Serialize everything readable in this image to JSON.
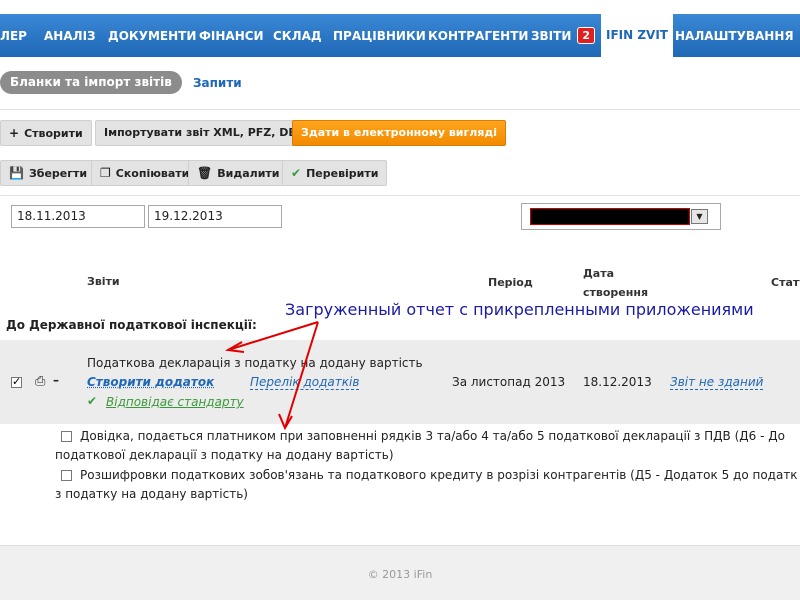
{
  "nav": {
    "items": [
      "ЛЕР",
      "АНАЛІЗ",
      "ДОКУМЕНТИ",
      "ФІНАНСИ",
      "СКЛАД",
      "ПРАЦІВНИКИ",
      "КОНТРАГЕНТИ",
      "ЗВІТИ"
    ],
    "badge": "2",
    "active": "IFIN ZVIT",
    "settings": "НАЛАШТУВАННЯ"
  },
  "subtabs": {
    "active": "Бланки та імпорт звітів",
    "other": "Запити"
  },
  "toolbar1": {
    "create": "Створити",
    "import": "Імпортувати звіт XML, PFZ, DBF",
    "submit": "Здати в електронному вигляді"
  },
  "toolbar2": {
    "save": "Зберегти",
    "copy": "Скопіювати",
    "delete": "Видалити",
    "check": "Перевірити"
  },
  "filters": {
    "date_from": "18.11.2013",
    "date_to": "19.12.2013"
  },
  "table": {
    "headers": {
      "reports": "Звіти",
      "period": "Період",
      "date_created_1": "Дата",
      "date_created_2": "створення",
      "status": "Стату"
    },
    "section": "До Державної податкової інспекції:",
    "row": {
      "title": "Податкова декларація з податку на додану вартість",
      "create_addon": "Створити додаток",
      "addon_list": "Перелік додатків",
      "standard": "Відповідає стандарту",
      "period": "За листопад 2013",
      "created": "18.12.2013",
      "status": "Звіт не зданий"
    },
    "subrows": [
      {
        "line1": "Довідка, подається платником при заповненні рядків 3 та/або 4 та/або 5 податкової декларації з ПДВ (Д6 - До",
        "line2": "податкової декларації з податку на додану вартість)"
      },
      {
        "line1": "Розшифровки податкових зобов'язань та податкового кредиту в розрізі контрагентів (Д5 - Додаток 5 до податк",
        "line2": "з податку на додану вартість)"
      }
    ]
  },
  "annotation": "Загруженный отчет с прикрепленными приложениями",
  "footer": "© 2013 iFin",
  "colors": {
    "nav": "#2a76c4",
    "accent_orange": "#f28a00",
    "annotation": "#1a1aa8",
    "arrow": "#e00000"
  }
}
